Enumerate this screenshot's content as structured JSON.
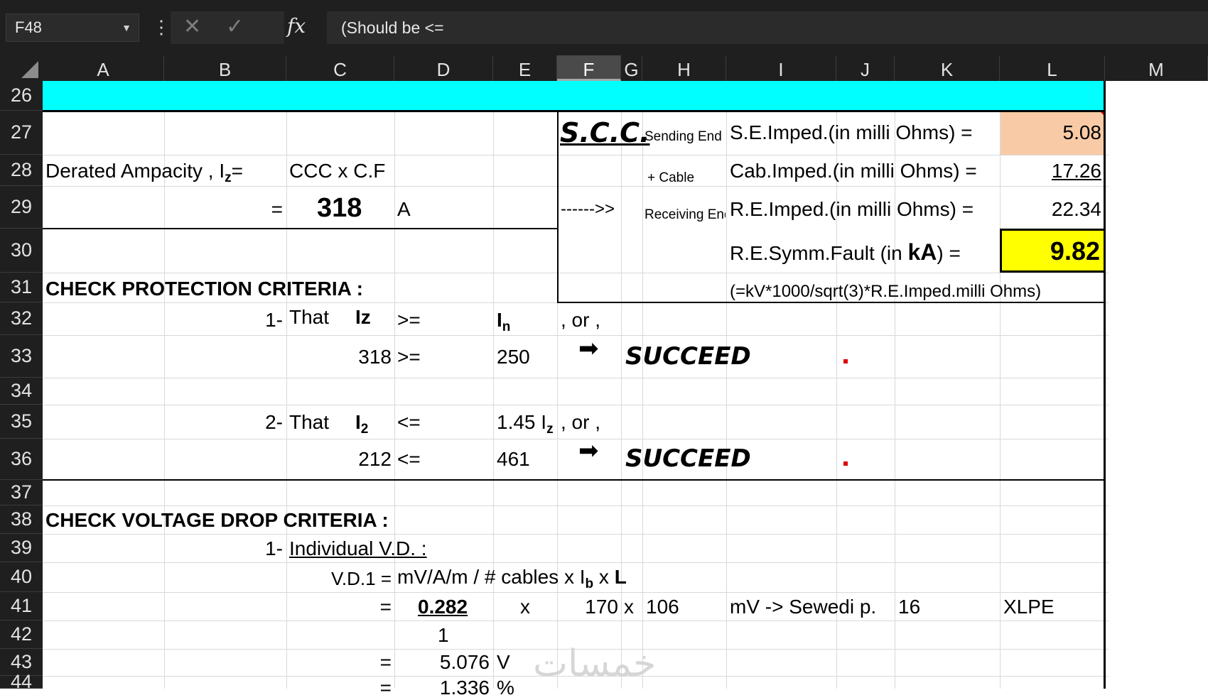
{
  "formula_bar": {
    "name_box": "F48",
    "menu_glyph": "⋮",
    "cancel_glyph": "✕",
    "enter_glyph": "✓",
    "fx_label": "fx",
    "formula": "(Should be  <="
  },
  "columns": [
    "A",
    "B",
    "C",
    "D",
    "E",
    "F",
    "G",
    "H",
    "I",
    "J",
    "K",
    "L",
    "M"
  ],
  "selected_column": "F",
  "rows": [
    "26",
    "27",
    "28",
    "29",
    "30",
    "31",
    "32",
    "33",
    "34",
    "35",
    "36",
    "37",
    "38",
    "39",
    "40",
    "41",
    "42",
    "43",
    "44"
  ],
  "colors": {
    "cyan_band": "#00ffff",
    "peach_cell": "#f8cba6",
    "yellow_cell": "#ffff00",
    "dark_ui": "#1f1f1f"
  },
  "cells": {
    "scc": "S.C.C.",
    "sending_end": "Sending End",
    "se_imped": "S.E.Imped.(in milli Ohms) =",
    "se_val": "5.08",
    "derated_label": "Derated Ampacity , I",
    "derated_sub": "z",
    "derated_eq": "=",
    "ccc_cf": "CCC x C.F",
    "plus_cable": "+ Cable",
    "cab_imped": "Cab.Imped.(in milli Ohms) =",
    "cab_val": "17.26",
    "eq1": "=",
    "val318": "318",
    "unit_a": "A",
    "arrow_text": "------>>",
    "receiving_end": "Receiving End",
    "re_imped": "R.E.Imped.(in milli Ohms) =",
    "re_val": "22.34",
    "re_symm_pre": "R.E.Symm.Fault  (in ",
    "re_symm_ka": "kA",
    "re_symm_post": ") =",
    "fault_val": "9.82",
    "check_prot": "CHECK PROTECTION CRITERIA :",
    "kv_formula": "(=kV*1000/sqrt(3)*R.E.Imped.milli Ohms)",
    "one_dash": "1-",
    "that1": "That",
    "iz": "Iz",
    "gte1": ">=",
    "in_i": "I",
    "in_sub": "n",
    "or1": ", or ,",
    "v318": "318",
    "gte2": ">=",
    "v250": "250",
    "arrow_glyph": "➡",
    "succeed1": "SUCCEED",
    "two_dash": "2-",
    "that2": "That",
    "i2_i": "I",
    "i2_sub": "2",
    "lte1": "<=",
    "v145": "1.45 I",
    "v145_sub": "z",
    "or2": ", or ,",
    "v212": "212",
    "lte2": "<=",
    "v461": "461",
    "succeed2": "SUCCEED",
    "check_vd": "CHECK VOLTAGE DROP CRITERIA :",
    "one_dash2": "1-",
    "individual_vd": "Individual V.D. :",
    "vd1_label": "V.D.1 =",
    "vd1_formula_a": "mV/A/m / # cables x I",
    "vd1_formula_sub": "b",
    "vd1_formula_b": " x ",
    "vd1_formula_l": "L",
    "eq41": "=",
    "v0282": "0.282",
    "x41a": "x",
    "v170": "170",
    "x41b": "x",
    "v106": "106",
    "mv_sewedi": "mV -> Sewedi p.",
    "v16": "16",
    "xlpe": "XLPE",
    "v1": "1",
    "eq43": "=",
    "v5076": "5.076",
    "unit_v": "V",
    "eq44": "=",
    "v1336": "1.336",
    "unit_pct": "%"
  },
  "watermark": "خمسات"
}
